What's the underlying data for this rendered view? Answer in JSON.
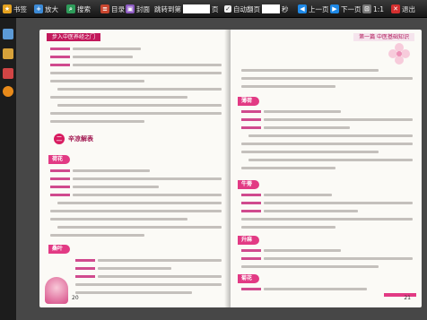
{
  "toolbar": {
    "items": [
      {
        "label": "书签",
        "icon": "bookmark-icon"
      },
      {
        "label": "放大",
        "icon": "zoom-in-icon"
      },
      {
        "label": "搜索",
        "icon": "search-icon"
      },
      {
        "label": "目录",
        "icon": "toc-icon"
      },
      {
        "label": "封面",
        "icon": "cover-icon"
      }
    ],
    "goto_label": "跳转到第",
    "goto_unit": "页",
    "autoplay_label": "自动翻页",
    "autoplay_unit": "秒",
    "prev_label": "上一页",
    "next_label": "下一页",
    "zoom_label": "1:1",
    "exit_label": "退出"
  },
  "left_page": {
    "header": "步入中医养经之门",
    "section_number": "二",
    "section_title": "辛凉解表",
    "herb_tags": [
      "荷花",
      "桑叶"
    ],
    "page_number": "20"
  },
  "right_page": {
    "header": "第一篇 中医基础知识",
    "herb_tags": [
      "薄荷",
      "牛蒡",
      "升麻",
      "菊花"
    ],
    "page_number": "21"
  },
  "colors": {
    "accent": "#e23a84",
    "header": "#c2185b"
  }
}
